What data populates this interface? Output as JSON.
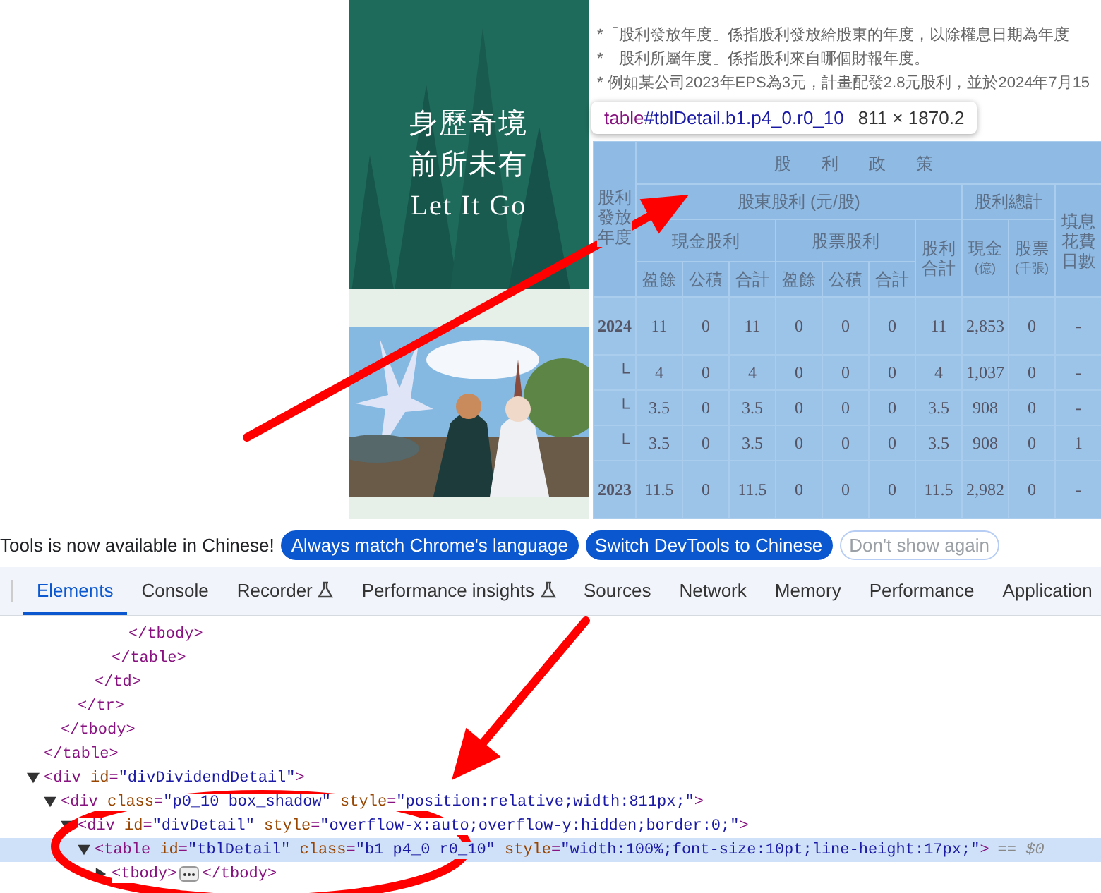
{
  "banner": {
    "kind": "picture",
    "lines": [
      "身歷奇境",
      "前所未有",
      "Let It Go"
    ]
  },
  "notes": [
    "*「股利發放年度」係指股利發放給股東的年度，以除權息日期為年度",
    "*「股利所屬年度」係指股利來自哪個財報年度。",
    "* 例如某公司2023年EPS為3元，計畫配發2.8元股利，並於2024年7月15"
  ],
  "tooltip": {
    "selector": "table#tblDetail.b1.p4_0.r0_10",
    "size": "811 × 1870.2"
  },
  "dividend_table": {
    "year_header": "股利發放年度",
    "title": "股利政策",
    "groups": [
      "股東股利 (元/股)",
      "股利總計"
    ],
    "subgroups": [
      "現金股利",
      "股票股利"
    ],
    "sub_columns": [
      "盈餘",
      "公積",
      "合計",
      "盈餘",
      "公積",
      "合計"
    ],
    "total_columns": [
      {
        "label": "股利合計"
      },
      {
        "label": "現金",
        "unit": "(億)"
      },
      {
        "label": "股票",
        "unit": "(千張)"
      }
    ],
    "last_column": "填息花費日數",
    "rows": [
      {
        "kind": "year",
        "label": "2024",
        "cells": [
          "11",
          "0",
          "11",
          "0",
          "0",
          "0",
          "11",
          "2,853",
          "0",
          "-"
        ]
      },
      {
        "kind": "sub",
        "label": "└",
        "cells": [
          "4",
          "0",
          "4",
          "0",
          "0",
          "0",
          "4",
          "1,037",
          "0",
          "-"
        ]
      },
      {
        "kind": "sub",
        "label": "└",
        "cells": [
          "3.5",
          "0",
          "3.5",
          "0",
          "0",
          "0",
          "3.5",
          "908",
          "0",
          "-"
        ]
      },
      {
        "kind": "sub",
        "label": "└",
        "cells": [
          "3.5",
          "0",
          "3.5",
          "0",
          "0",
          "0",
          "3.5",
          "908",
          "0",
          "1"
        ]
      },
      {
        "kind": "year",
        "label": "2023",
        "cells": [
          "11.5",
          "0",
          "11.5",
          "0",
          "0",
          "0",
          "11.5",
          "2,982",
          "0",
          "-"
        ]
      }
    ]
  },
  "infobar": {
    "message": "Tools is now available in Chinese!",
    "buttons": [
      {
        "label": "Always match Chrome's language",
        "kind": "primary"
      },
      {
        "label": "Switch DevTools to Chinese",
        "kind": "primary"
      },
      {
        "label": "Don't show again",
        "kind": "outline"
      }
    ]
  },
  "tabs": [
    {
      "label": "Elements",
      "selected": true,
      "experimental": false
    },
    {
      "label": "Console",
      "selected": false,
      "experimental": false
    },
    {
      "label": "Recorder",
      "selected": false,
      "experimental": true
    },
    {
      "label": "Performance insights",
      "selected": false,
      "experimental": true
    },
    {
      "label": "Sources",
      "selected": false,
      "experimental": false
    },
    {
      "label": "Network",
      "selected": false,
      "experimental": false
    },
    {
      "label": "Memory",
      "selected": false,
      "experimental": false
    },
    {
      "label": "Performance",
      "selected": false,
      "experimental": false
    },
    {
      "label": "Application",
      "selected": false,
      "experimental": false
    }
  ],
  "dom_tree": [
    {
      "kind": "close",
      "text": "</table>",
      "selected": false,
      "children": [
        {
          "kind": "close",
          "text": "</tbody>",
          "selected": false,
          "children": [
            {
              "kind": "close",
              "text": "</tr>",
              "selected": false,
              "children": [
                {
                  "kind": "close",
                  "text": "</td>",
                  "selected": false,
                  "children": [
                    {
                      "kind": "close",
                      "text": "</table>",
                      "selected": false,
                      "children": [
                        {
                          "kind": "close",
                          "text": "</tbody>",
                          "selected": false
                        }
                      ]
                    }
                  ]
                }
              ]
            }
          ]
        }
      ]
    },
    {
      "kind": "open",
      "text": "<div id=\"divDividendDetail\">",
      "expanded": true,
      "selected": false,
      "children": [
        {
          "kind": "open",
          "text": "<div class=\"p0_10 box_shadow\" style=\"position:relative;width:811px;\">",
          "expanded": true,
          "selected": false,
          "children": [
            {
              "kind": "open",
              "text": "<div id=\"divDetail\" style=\"overflow-x:auto;overflow-y:hidden;border:0;\">",
              "expanded": true,
              "selected": false,
              "children": [
                {
                  "kind": "open",
                  "text": "<table id=\"tblDetail\" class=\"b1 p4_0 r0_10\" style=\"width:100%;font-size:10pt;line-height:17px;\">",
                  "marker": "== $0",
                  "expanded": true,
                  "selected": true,
                  "children": [
                    {
                      "kind": "open",
                      "text": "<tbody>",
                      "end": "</tbody>",
                      "expanded": false,
                      "selected": false
                    }
                  ]
                }
              ]
            }
          ]
        }
      ]
    }
  ],
  "annotations": [
    {
      "kind": "arrow"
    },
    {
      "kind": "arrow"
    },
    {
      "kind": "ellipse"
    }
  ]
}
